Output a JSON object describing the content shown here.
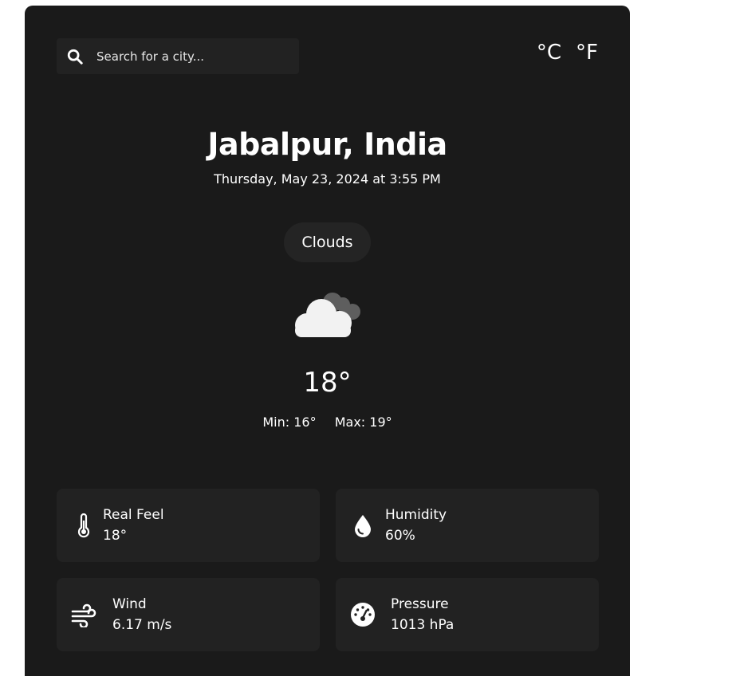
{
  "search": {
    "placeholder": "Search for a city..."
  },
  "units": {
    "celsius": "°C",
    "fahrenheit": "°F"
  },
  "location": {
    "city": "Jabalpur, India",
    "datetime": "Thursday, May 23, 2024 at 3:55 PM"
  },
  "weather": {
    "condition": "Clouds",
    "icon": "clouds-icon",
    "temperature": "18°",
    "min": "Min: 16°",
    "max": "Max: 19°"
  },
  "details": [
    {
      "label": "Real Feel",
      "value": "18°",
      "icon": "thermometer-icon"
    },
    {
      "label": "Humidity",
      "value": "60%",
      "icon": "droplet-icon"
    },
    {
      "label": "Wind",
      "value": "6.17 m/s",
      "icon": "wind-icon"
    },
    {
      "label": "Pressure",
      "value": "1013 hPa",
      "icon": "gauge-icon"
    }
  ],
  "colors": {
    "card": "#1a1a1a",
    "tile": "#222222",
    "text": "#ffffff"
  }
}
